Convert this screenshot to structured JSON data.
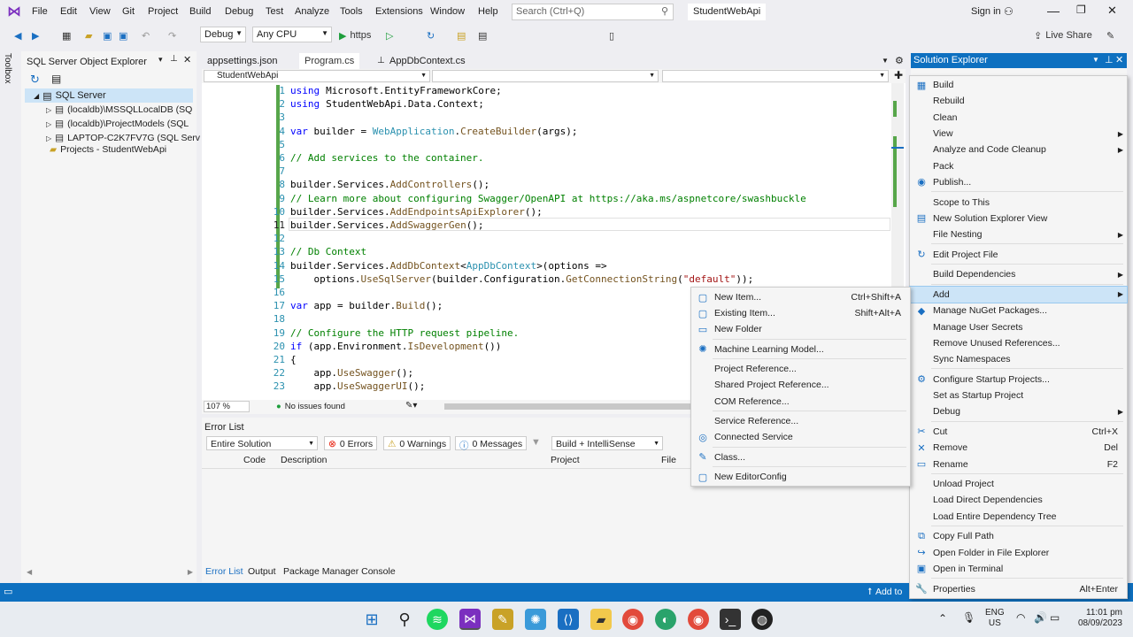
{
  "menubar": {
    "items": [
      "File",
      "Edit",
      "View",
      "Git",
      "Project",
      "Build",
      "Debug",
      "Test",
      "Analyze",
      "Tools",
      "Extensions",
      "Window",
      "Help"
    ],
    "search_placeholder": "Search (Ctrl+Q)",
    "solution_name": "StudentWebApi",
    "sign_in": "Sign in"
  },
  "toolbar": {
    "config": "Debug",
    "platform": "Any CPU",
    "run_label": "https",
    "live_share": "Live Share"
  },
  "toolbox_label": "Toolbox",
  "sql_explorer": {
    "title": "SQL Server Object Explorer",
    "root": "SQL Server",
    "nodes": [
      "(localdb)\\MSSQLLocalDB (SQ",
      "(localdb)\\ProjectModels (SQL",
      "LAPTOP-C2K7FV7G (SQL Serv"
    ],
    "projects": "Projects - StudentWebApi"
  },
  "editor": {
    "tabs": [
      "appsettings.json",
      "Program.cs",
      "AppDbContext.cs"
    ],
    "nav_left": "StudentWebApi",
    "zoom": "107 %",
    "issues": "No issues found",
    "lines": [
      {
        "n": "1",
        "t": [
          [
            "kw",
            "using"
          ],
          [
            "",
            "Microsoft.EntityFrameworkCore;"
          ]
        ]
      },
      {
        "n": "2",
        "t": [
          [
            "kw",
            "using"
          ],
          [
            "",
            "StudentWebApi.Data.Context;"
          ]
        ]
      },
      {
        "n": "3",
        "t": []
      },
      {
        "n": "4",
        "t": [
          [
            "kw",
            "var"
          ],
          [
            "",
            " builder = "
          ],
          [
            "ty",
            "WebApplication"
          ],
          [
            "",
            "."
          ],
          [
            "mt",
            "CreateBuilder"
          ],
          [
            "",
            "(args);"
          ]
        ]
      },
      {
        "n": "5",
        "t": []
      },
      {
        "n": "6",
        "t": [
          [
            "cm",
            "// Add services to the container."
          ]
        ]
      },
      {
        "n": "7",
        "t": []
      },
      {
        "n": "8",
        "t": [
          [
            "",
            "builder.Services."
          ],
          [
            "mt",
            "AddControllers"
          ],
          [
            "",
            "();"
          ]
        ]
      },
      {
        "n": "9",
        "t": [
          [
            "cm",
            "// Learn more about configuring Swagger/OpenAPI at https://aka.ms/aspnetcore/swashbuckle"
          ]
        ]
      },
      {
        "n": "10",
        "t": [
          [
            "",
            "builder.Services."
          ],
          [
            "mt",
            "AddEndpointsApiExplorer"
          ],
          [
            "",
            "();"
          ]
        ]
      },
      {
        "n": "11",
        "t": [
          [
            "",
            "builder.Services."
          ],
          [
            "mt",
            "AddSwaggerGen"
          ],
          [
            "",
            "();"
          ]
        ]
      },
      {
        "n": "12",
        "t": []
      },
      {
        "n": "13",
        "t": [
          [
            "cm",
            "// Db Context"
          ]
        ]
      },
      {
        "n": "14",
        "t": [
          [
            "",
            "builder.Services."
          ],
          [
            "mt",
            "AddDbContext"
          ],
          [
            "",
            "<"
          ],
          [
            "ty",
            "AppDbContext"
          ],
          [
            "",
            ">(options =>"
          ]
        ]
      },
      {
        "n": "15",
        "t": [
          [
            "",
            "    options."
          ],
          [
            "mt",
            "UseSqlServer"
          ],
          [
            "",
            "(builder.Configuration."
          ],
          [
            "mt",
            "GetConnectionString"
          ],
          [
            "",
            "("
          ],
          [
            "st",
            "\"default\""
          ],
          [
            "",
            "));"
          ]
        ]
      },
      {
        "n": "16",
        "t": []
      },
      {
        "n": "17",
        "t": [
          [
            "kw",
            "var"
          ],
          [
            "",
            " app = builder."
          ],
          [
            "mt",
            "Build"
          ],
          [
            "",
            "();"
          ]
        ]
      },
      {
        "n": "18",
        "t": []
      },
      {
        "n": "19",
        "t": [
          [
            "cm",
            "// Configure the HTTP request pipeline."
          ]
        ]
      },
      {
        "n": "20",
        "t": [
          [
            "kw",
            "if"
          ],
          [
            "",
            " (app.Environment."
          ],
          [
            "mt",
            "IsDevelopment"
          ],
          [
            "",
            "())"
          ]
        ]
      },
      {
        "n": "21",
        "t": [
          [
            "",
            "{"
          ]
        ]
      },
      {
        "n": "22",
        "t": [
          [
            "",
            "    app."
          ],
          [
            "mt",
            "UseSwagger"
          ],
          [
            "",
            "();"
          ]
        ]
      },
      {
        "n": "23",
        "t": [
          [
            "",
            "    app."
          ],
          [
            "mt",
            "UseSwaggerUI"
          ],
          [
            "",
            "();"
          ]
        ]
      }
    ]
  },
  "error_list": {
    "title": "Error List",
    "scope": "Entire Solution",
    "errors": "0 Errors",
    "warnings": "0 Warnings",
    "messages": "0 Messages",
    "filter": "Build + IntelliSense",
    "cols": [
      "Code",
      "Description",
      "Project",
      "File"
    ],
    "bottom_tabs": [
      "Error List",
      "Output",
      "Package Manager Console"
    ]
  },
  "solution_explorer": {
    "title": "Solution Explorer"
  },
  "context_menu": [
    {
      "label": "Build",
      "icon": "▦"
    },
    {
      "label": "Rebuild"
    },
    {
      "label": "Clean"
    },
    {
      "label": "View",
      "sub": true
    },
    {
      "label": "Analyze and Code Cleanup",
      "sub": true
    },
    {
      "label": "Pack"
    },
    {
      "label": "Publish...",
      "icon": "◉"
    },
    {
      "sep": true
    },
    {
      "label": "Scope to This"
    },
    {
      "label": "New Solution Explorer View",
      "icon": "▤"
    },
    {
      "label": "File Nesting",
      "sub": true
    },
    {
      "sep": true
    },
    {
      "label": "Edit Project File",
      "icon": "↻"
    },
    {
      "sep": true
    },
    {
      "label": "Build Dependencies",
      "sub": true
    },
    {
      "sep": true
    },
    {
      "label": "Add",
      "sub": true,
      "hl": true
    },
    {
      "label": "Manage NuGet Packages...",
      "icon": "◆"
    },
    {
      "label": "Manage User Secrets"
    },
    {
      "label": "Remove Unused References..."
    },
    {
      "label": "Sync Namespaces"
    },
    {
      "sep": true
    },
    {
      "label": "Configure Startup Projects...",
      "icon": "⚙"
    },
    {
      "label": "Set as Startup Project"
    },
    {
      "label": "Debug",
      "sub": true
    },
    {
      "sep": true
    },
    {
      "label": "Cut",
      "icon": "✂",
      "sc": "Ctrl+X"
    },
    {
      "label": "Remove",
      "icon": "✕",
      "sc": "Del"
    },
    {
      "label": "Rename",
      "icon": "▭",
      "sc": "F2"
    },
    {
      "sep": true
    },
    {
      "label": "Unload Project"
    },
    {
      "label": "Load Direct Dependencies"
    },
    {
      "label": "Load Entire Dependency Tree"
    },
    {
      "sep": true
    },
    {
      "label": "Copy Full Path",
      "icon": "⧉"
    },
    {
      "label": "Open Folder in File Explorer",
      "icon": "↪"
    },
    {
      "label": "Open in Terminal",
      "icon": "▣"
    },
    {
      "sep": true
    },
    {
      "label": "Properties",
      "icon": "🔧",
      "sc": "Alt+Enter"
    }
  ],
  "add_submenu": [
    {
      "label": "New Item...",
      "icon": "▢",
      "sc": "Ctrl+Shift+A"
    },
    {
      "label": "Existing Item...",
      "icon": "▢",
      "sc": "Shift+Alt+A"
    },
    {
      "label": "New Folder",
      "icon": "▭"
    },
    {
      "sep": true
    },
    {
      "label": "Machine Learning Model...",
      "icon": "✺"
    },
    {
      "sep": true
    },
    {
      "label": "Project Reference..."
    },
    {
      "label": "Shared Project Reference..."
    },
    {
      "label": "COM Reference..."
    },
    {
      "sep": true
    },
    {
      "label": "Service Reference..."
    },
    {
      "label": "Connected Service",
      "icon": "◎"
    },
    {
      "sep": true
    },
    {
      "label": "Class...",
      "icon": "✎"
    },
    {
      "sep": true
    },
    {
      "label": "New EditorConfig",
      "icon": "▢"
    }
  ],
  "statusbar": {
    "add_source": "Add to"
  },
  "taskbar": {
    "lang": "ENG",
    "region": "US",
    "time": "11:01 pm",
    "date": "08/09/2023"
  }
}
